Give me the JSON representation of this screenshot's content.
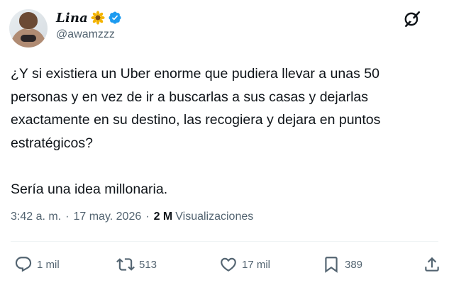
{
  "author": {
    "display_name": "Lina",
    "handle": "@awamzzz"
  },
  "tweet": {
    "paragraph1": "¿Y si existiera un Uber enorme que pudiera llevar a unas 50 personas y en vez de ir a buscarlas a sus casas y dejarlas exactamente en su destino, las recogiera y dejara en puntos estratégicos?",
    "paragraph2": "Sería una idea millonaria."
  },
  "meta": {
    "time": "3:42 a. m.",
    "separator": "·",
    "date": "17 may. 2026",
    "views_count": "2 M",
    "views_label": "Visualizaciones"
  },
  "actions": {
    "replies": "1 mil",
    "reposts": "513",
    "likes": "17 mil",
    "bookmarks": "389"
  },
  "colors": {
    "text": "#0f1419",
    "secondary": "#536471",
    "verified": "#1d9bf0",
    "flower": "#f4b400"
  },
  "icons": [
    "sunflower-icon",
    "verified-badge-icon",
    "grok-icon",
    "reply-icon",
    "repost-icon",
    "like-icon",
    "bookmark-icon",
    "share-icon"
  ]
}
